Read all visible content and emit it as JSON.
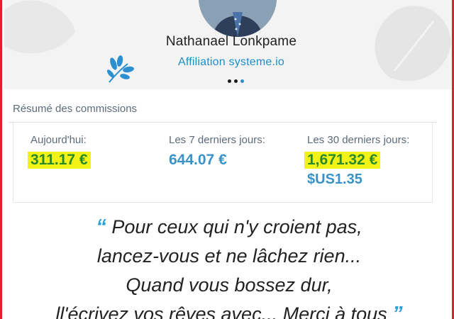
{
  "profile": {
    "name": "Nathanael Lonkpame",
    "affiliation_link": "Affiliation systeme.io",
    "carousel_dots": 3,
    "active_dot": 3
  },
  "commissions": {
    "title": "Résumé des commissions",
    "today": {
      "label": "Aujourd'hui:",
      "value": "311.17 €",
      "highlighted": true
    },
    "last7": {
      "label": "Les 7 derniers jours:",
      "value": "644.07 €",
      "highlighted": false
    },
    "last30": {
      "label": "Les 30 derniers jours:",
      "value": "1,671.32 €",
      "value2": "$US1.35",
      "highlighted": true
    }
  },
  "quote": {
    "open_mark": "“",
    "line1": "Pour ceux qui n'y croient pas,",
    "line2": "lancez-vous et ne lâchez rien...",
    "line3": "Quand vous bossez dur,",
    "line4": "ll'écrivez vos rêves avec... Merci à tous",
    "close_mark": "”"
  },
  "colors": {
    "accent_blue": "#2b8fd0",
    "value_green": "#2a8a2a",
    "value_blue": "#3a93c8",
    "highlight_yellow": "#f2f216",
    "frame_red": "#d9242b"
  }
}
